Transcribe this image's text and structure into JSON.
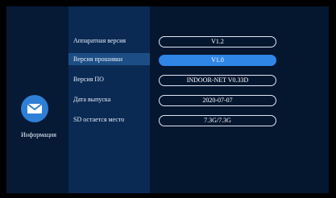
{
  "left_panel": {
    "label": "Информация",
    "icon": "envelope-icon"
  },
  "menu": [
    {
      "label": "Аппаратная версия",
      "value": "V1.2",
      "selected": false
    },
    {
      "label": "Версия прошивки",
      "value": "V1.0",
      "selected": true
    },
    {
      "label": "Версия ПО",
      "value": "INDOOR-NET V0.33D",
      "selected": false
    },
    {
      "label": "Дата выпуска",
      "value": "2020-07-07",
      "selected": false
    },
    {
      "label": "SD остается место",
      "value": "7.3G/7.3G",
      "selected": false
    }
  ],
  "colors": {
    "screen_bg": "#05162f",
    "menu_bg": "#0a2a54",
    "selected_row": "#1c4e85",
    "accent": "#2f86e6",
    "icon_bg": "#2e7fd6"
  }
}
